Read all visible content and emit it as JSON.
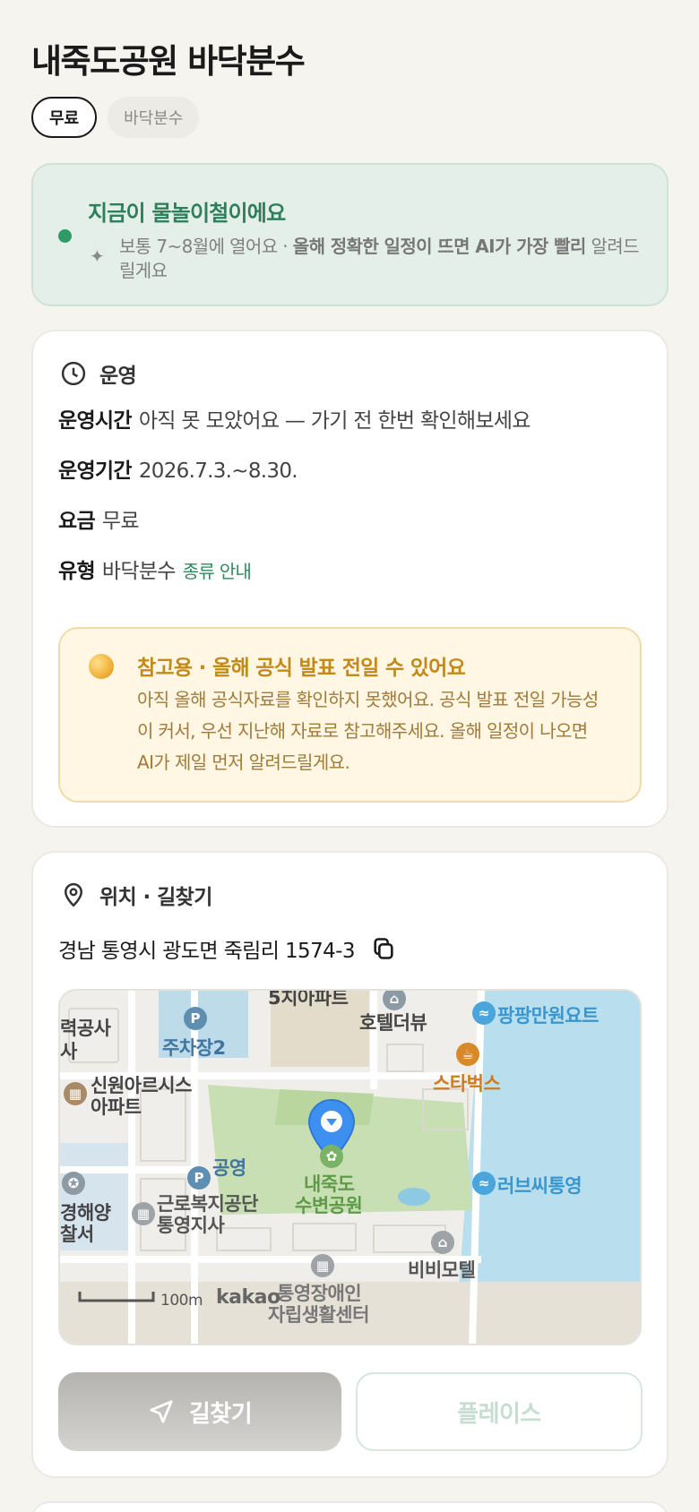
{
  "title": "내죽도공원 바닥분수",
  "tags": {
    "primary": "무료",
    "secondary": "바닥분수"
  },
  "season": {
    "headline": "지금이 물놀이철이에요",
    "note_lead": "보통 7~8월에 열어요 · ",
    "note_bold": "올해 정확한 일정이 뜨면 AI가 가장 빨리",
    "note_tail": "알려드릴게요",
    "status_color": "#2e9a68"
  },
  "operation": {
    "section_label": "운영",
    "hours_key": "운영시간",
    "hours_value": "아직 못 모았어요 — 가기 전 한번 확인해보세요",
    "period_key": "운영기간",
    "period_value": "2026.7.3.~8.30.",
    "fee_key": "요금",
    "fee_value": "무료",
    "type_key": "유형",
    "type_value": "바닥분수",
    "type_link": "종류 안내"
  },
  "notice": {
    "title": "참고용 · 올해 공식 발표 전일 수 있어요",
    "body": "아직 올해 공식자료를 확인하지 못했어요. 공식 발표 전일 가능성이 커서, 우선 지난해 자료로 참고해주세요. 올해 일정이 나오면 AI가 제일 먼저 알려드릴게요."
  },
  "location": {
    "section_label": "위치 · 길찾기",
    "address": "경남 통영시 광도면 죽림리 1574-3"
  },
  "map": {
    "labels": {
      "l1": "5치아파트",
      "l2": "력공사",
      "l3": "사",
      "l4": "주차장2",
      "l5": "호텔더뷰",
      "l6": "팡팡만원요트",
      "l7": "신원아르시스",
      "l8": "아파트",
      "l9": "스타벅스",
      "l10": "공영",
      "l11": "내죽도",
      "l12": "수변공원",
      "l13": "러브씨통영",
      "l14": "경해양",
      "l15": "찰서",
      "l16": "근로복지공단",
      "l17": "통영지사",
      "l18": "비비모텔",
      "l19": "통영장애인",
      "l20": "자립생활센터",
      "scale": "100m",
      "brand": "kakao"
    }
  },
  "buttons": {
    "navigate": "길찾기",
    "place": "플레이스"
  }
}
